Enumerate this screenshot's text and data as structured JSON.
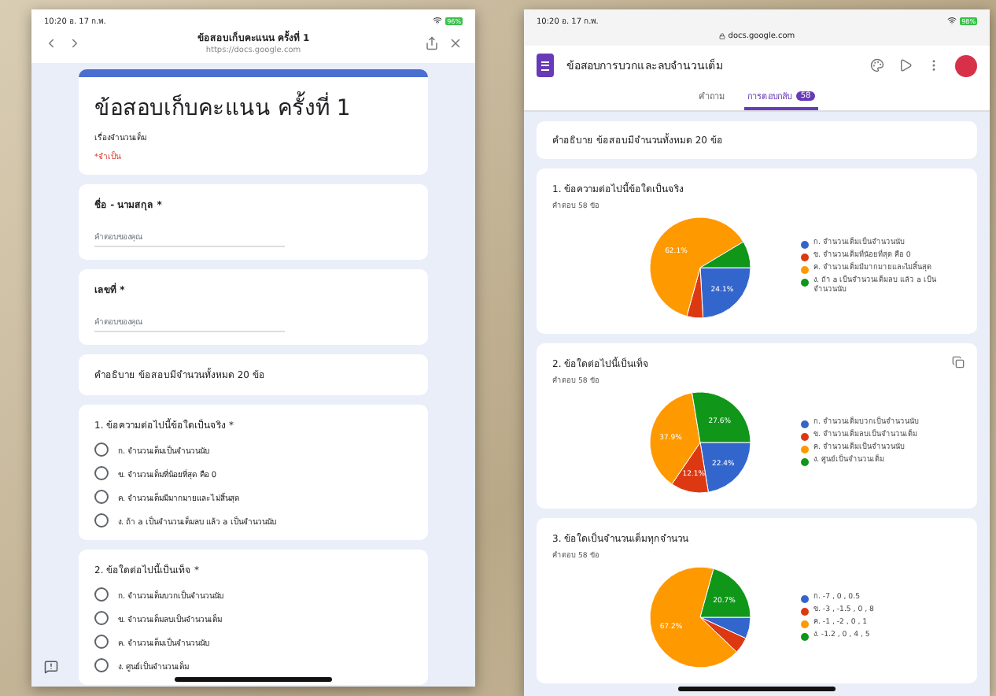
{
  "left_screen": {
    "status_bar": {
      "time": "10:20 อ. 17 ก.พ.",
      "battery": "96%"
    },
    "browser": {
      "title": "ข้อสอบเก็บคะแนน ครั้งที่ 1",
      "url": "https://docs.google.com"
    },
    "form": {
      "title": "ข้อสอบเก็บคะแนน ครั้งที่ 1",
      "description": "เรื่องจำนวนเต็ม",
      "required_note": "*จำเป็น"
    },
    "fields": [
      {
        "label": "ชื่อ - นามสกุล *",
        "placeholder": "คำตอบของคุณ"
      },
      {
        "label": "เลขที่ *",
        "placeholder": "คำตอบของคุณ"
      }
    ],
    "section_note": "คำอธิบาย ข้อสอบมีจำนวนทั้งหมด 20 ข้อ",
    "questions": [
      {
        "title": "1. ข้อความต่อไปนี้ข้อใดเป็นจริง *",
        "options": [
          {
            "label": "ก. จำนวนเต็มเป็นจำนวนนับ",
            "selected": false
          },
          {
            "label": "ข. จำนวนเต็มที่น้อยที่สุด คือ 0",
            "selected": false
          },
          {
            "label": "ค. จำนวนเต็มมีมากมายและไม่สิ้นสุด",
            "selected": false
          },
          {
            "label": "ง. ถ้า a เป็นจำนวนเต็มลบ แล้ว a เป็นจำนวนนับ",
            "selected": false
          }
        ]
      },
      {
        "title": "2. ข้อใดต่อไปนี้เป็นเท็จ *",
        "options": [
          {
            "label": "ก. จำนวนเต็มบวกเป็นจำนวนนับ",
            "selected": false
          },
          {
            "label": "ข. จำนวนเต็มลบเป็นจำนวนเต็ม",
            "selected": false
          },
          {
            "label": "ค. จำนวนเต็มเป็นจำนวนนับ",
            "selected": false
          },
          {
            "label": "ง. ศูนย์เป็นจำนวนเต็ม",
            "selected": false
          }
        ]
      }
    ]
  },
  "right_screen": {
    "status_bar": {
      "time": "10:20 อ. 17 ก.พ.",
      "battery": "98%"
    },
    "url": "docs.google.com",
    "app_title": "ข้อสอบการบวกและลบจำนวนเต็ม",
    "tabs": [
      {
        "label": "คำถาม",
        "selected": false
      },
      {
        "label": "การตอบกลับ",
        "selected": true,
        "badge": "58"
      }
    ],
    "description": "คำอธิบาย ข้อสอบมีจำนวนทั้งหมด 20 ข้อ",
    "questions": [
      {
        "title": "1. ข้อความต่อไปนี้ข้อใดเป็นจริง",
        "count": "คำตอบ 58 ข้อ",
        "copyable": false,
        "chart_data": {
          "type": "pie",
          "categories": [
            "ก. จำนวนเต็มเป็นจำนวนนับ",
            "ข. จำนวนเต็มที่น้อยที่สุด คือ 0",
            "ค. จำนวนเต็มมีมากมายและไม่สิ้นสุด",
            "ง. ถ้า a เป็นจำนวนเต็มลบ แล้ว a เป็นจำนวนนับ"
          ],
          "series": [
            {
              "values": [
                24.1,
                5.2,
                62.1,
                8.6
              ]
            }
          ],
          "value_labels": [
            "24.1%",
            null,
            "62.1%",
            null
          ]
        }
      },
      {
        "title": "2. ข้อใดต่อไปนี้เป็นเท็จ",
        "count": "คำตอบ 58 ข้อ",
        "copyable": true,
        "chart_data": {
          "type": "pie",
          "categories": [
            "ก. จำนวนเต็มบวกเป็นจำนวนนับ",
            "ข. จำนวนเต็มลบเป็นจำนวนเต็ม",
            "ค. จำนวนเต็มเป็นจำนวนนับ",
            "ง. ศูนย์เป็นจำนวนเต็ม"
          ],
          "series": [
            {
              "values": [
                22.4,
                12.1,
                37.9,
                27.6
              ]
            }
          ],
          "value_labels": [
            "22.4%",
            "12.1%",
            "37.9%",
            "27.6%"
          ]
        }
      },
      {
        "title": "3. ข้อใดเป็นจำนวนเต็มทุกจำนวน",
        "count": "คำตอบ 58 ข้อ",
        "copyable": false,
        "chart_data": {
          "type": "pie",
          "categories": [
            "ก. -7 , 0 , 0.5",
            "ข. -3 , -1.5 , 0 , 8",
            "ค. -1 , -2 , 0 , 1",
            "ง. -1.2 , 0 , 4 , 5"
          ],
          "series": [
            {
              "values": [
                6.9,
                5.2,
                67.2,
                20.7
              ]
            }
          ],
          "value_labels": [
            null,
            null,
            "67.2%",
            "20.7%"
          ]
        }
      }
    ]
  }
}
